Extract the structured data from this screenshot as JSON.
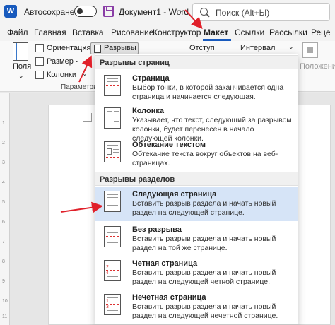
{
  "titlebar": {
    "app_letter": "W",
    "autosave_label": "Автосохранение",
    "doc_title": "Документ1 - Word",
    "search_placeholder": "Поиск (Alt+Ы)"
  },
  "ribbon_tabs": [
    {
      "label": "Файл"
    },
    {
      "label": "Главная"
    },
    {
      "label": "Вставка"
    },
    {
      "label": "Рисование"
    },
    {
      "label": "Конструктор"
    },
    {
      "label": "Макет",
      "active": true
    },
    {
      "label": "Ссылки"
    },
    {
      "label": "Рассылки"
    },
    {
      "label": "Реце"
    }
  ],
  "ribbon": {
    "margins_label": "Поля",
    "orientation_label": "Ориентация",
    "size_label": "Размер",
    "columns_label": "Колонки",
    "breaks_label": "Разрывы",
    "group_label": "Параметры",
    "indent_label": "Отступ",
    "spacing_label": "Интервал",
    "position_label": "Положение"
  },
  "ruler_numbers": [
    "1",
    "2",
    "3",
    "4",
    "5",
    "6",
    "7",
    "8",
    "9",
    "10",
    "11"
  ],
  "dropdown": {
    "page_breaks_header": "Разрывы страниц",
    "section_breaks_header": "Разрывы разделов",
    "page_breaks": [
      {
        "title": "Страница",
        "desc": "Выбор точки, в которой заканчивается одна страница и начинается следующая."
      },
      {
        "title": "Колонка",
        "desc": "Указывает, что текст, следующий за разрывом колонки, будет перенесен в начало следующей колонки."
      },
      {
        "title": "Обтекание текстом",
        "desc": "Обтекание текста вокруг объектов на веб-страницах."
      }
    ],
    "section_breaks": [
      {
        "title": "Следующая страница",
        "desc": "Вставить разрыв раздела и начать новый раздел на следующей странице.",
        "highlighted": true
      },
      {
        "title": "Без разрыва",
        "desc": "Вставить разрыв раздела и начать новый раздел на той же странице."
      },
      {
        "title": "Четная страница",
        "desc": "Вставить разрыв раздела и начать новый раздел на следующей четной странице."
      },
      {
        "title": "Нечетная страница",
        "desc": "Вставить разрыв раздела и начать новый раздел на следующей нечетной странице."
      }
    ]
  },
  "colors": {
    "word_blue": "#185abd",
    "annotation_red": "#e0202a",
    "highlight": "#d6e4f7"
  }
}
